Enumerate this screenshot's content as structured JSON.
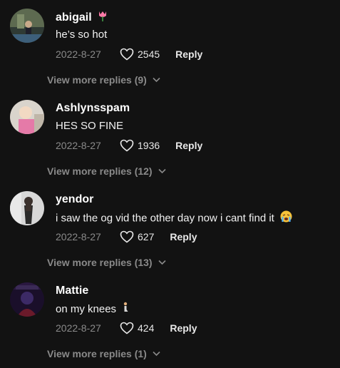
{
  "comments": [
    {
      "username": "abigail",
      "username_emoji": "tulip-emoji",
      "text": "he’s so hot",
      "date": "2022-8-27",
      "likes": "2545",
      "reply": "Reply",
      "more_replies": "View more replies (9)"
    },
    {
      "username": "Ashlynsspam",
      "text": "HES SO FINE",
      "date": "2022-8-27",
      "likes": "1936",
      "reply": "Reply",
      "more_replies": "View more replies (12)"
    },
    {
      "username": "yendor",
      "text": "i saw the og vid the other day now i cant find it",
      "text_emoji": "crying-face-emoji",
      "date": "2022-8-27",
      "likes": "627",
      "reply": "Reply",
      "more_replies": "View more replies (13)"
    },
    {
      "username": "Mattie",
      "text": "on my knees",
      "text_emoji": "kneeling-person-emoji",
      "date": "2022-8-27",
      "likes": "424",
      "reply": "Reply",
      "more_replies": "View more replies (1)"
    }
  ],
  "icons": {
    "like": "heart-outline-icon",
    "expand": "chevron-down-icon"
  },
  "colors": {
    "background": "#121212",
    "muted": "#8a8a8a",
    "text": "#ffffff"
  }
}
